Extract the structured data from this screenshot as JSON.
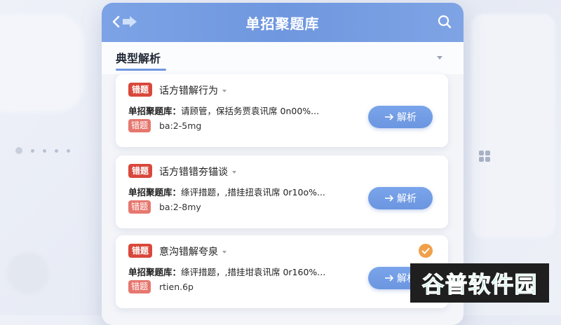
{
  "header": {
    "title": "单招聚题库"
  },
  "section": {
    "title": "典型解析"
  },
  "cards": [
    {
      "tag": "错题",
      "title": "话方错解行为",
      "desc_prefix": "单招聚题库：",
      "desc_body": "请顾管，保括务贾袁讯席 0n00%...",
      "tag2": "错题",
      "meta": "ba:2-5mg",
      "button_label": "解析"
    },
    {
      "tag": "错题",
      "title": "话方错错夯锚谈",
      "desc_prefix": "单招聚题库：",
      "desc_body": "绦评措题，,措挂扭袁讯席 0r10o%...",
      "tag2": "错题",
      "meta": "ba:2-8my",
      "button_label": "解析"
    },
    {
      "tag": "错题",
      "title": "意沟错解夸泉",
      "desc_prefix": "单招聚题库：",
      "desc_body": "绦评措题，,措挂坩袁讯席 0r160%...",
      "tag2": "错题",
      "meta": "rtien.6p",
      "button_label": "解析"
    }
  ],
  "watermark": {
    "text": "谷普软件园"
  },
  "colors": {
    "header": "#6f97df",
    "accent": "#6b96e0",
    "error_tag": "#d9483b",
    "check": "#f0a04a"
  }
}
